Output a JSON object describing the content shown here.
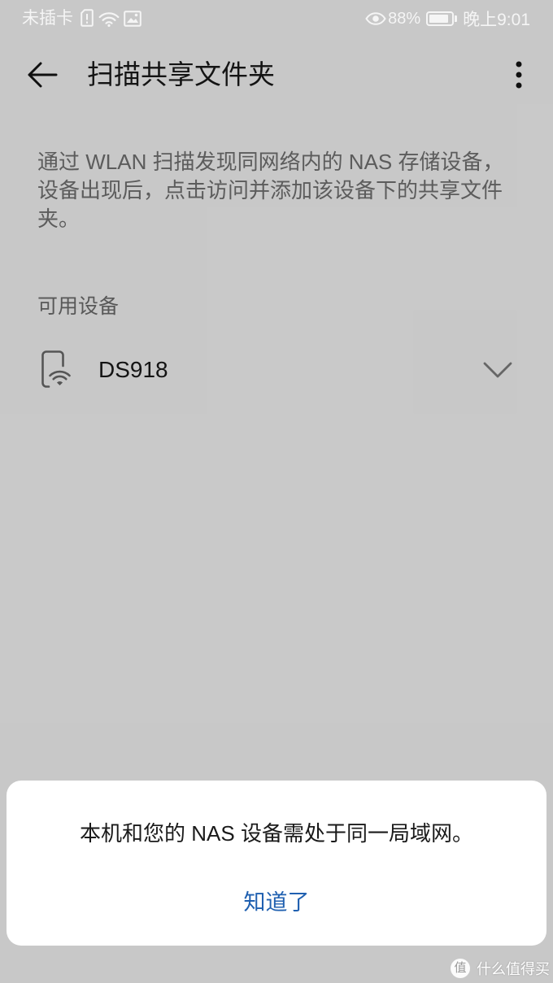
{
  "status_bar": {
    "carrier": "未插卡",
    "icons": [
      "sim-alert-icon",
      "wifi-icon",
      "image-icon",
      "eye-icon",
      "battery-icon"
    ],
    "battery_percent": "88%",
    "battery_level": 88,
    "time": "晚上9:01"
  },
  "appbar": {
    "title": "扫描共享文件夹",
    "icons": [
      "back-arrow-icon",
      "more-vertical-icon"
    ]
  },
  "main": {
    "description": "通过 WLAN 扫描发现同网络内的 NAS 存储设备，设备出现后，点击访问并添加该设备下的共享文件夹。",
    "section_title": "可用设备",
    "devices": [
      {
        "name": "DS918",
        "icon": "phone-wifi-icon",
        "expand_icon": "chevron-down-icon"
      }
    ]
  },
  "dialog": {
    "message": "本机和您的 NAS 设备需处于同一局域网。",
    "confirm_label": "知道了"
  },
  "watermark": {
    "logo_char": "值",
    "text": "什么值得买"
  },
  "colors": {
    "accent": "#2060b0",
    "scrim": "rgba(0,0,0,0.2)",
    "dialog_background": "#ffffff"
  }
}
